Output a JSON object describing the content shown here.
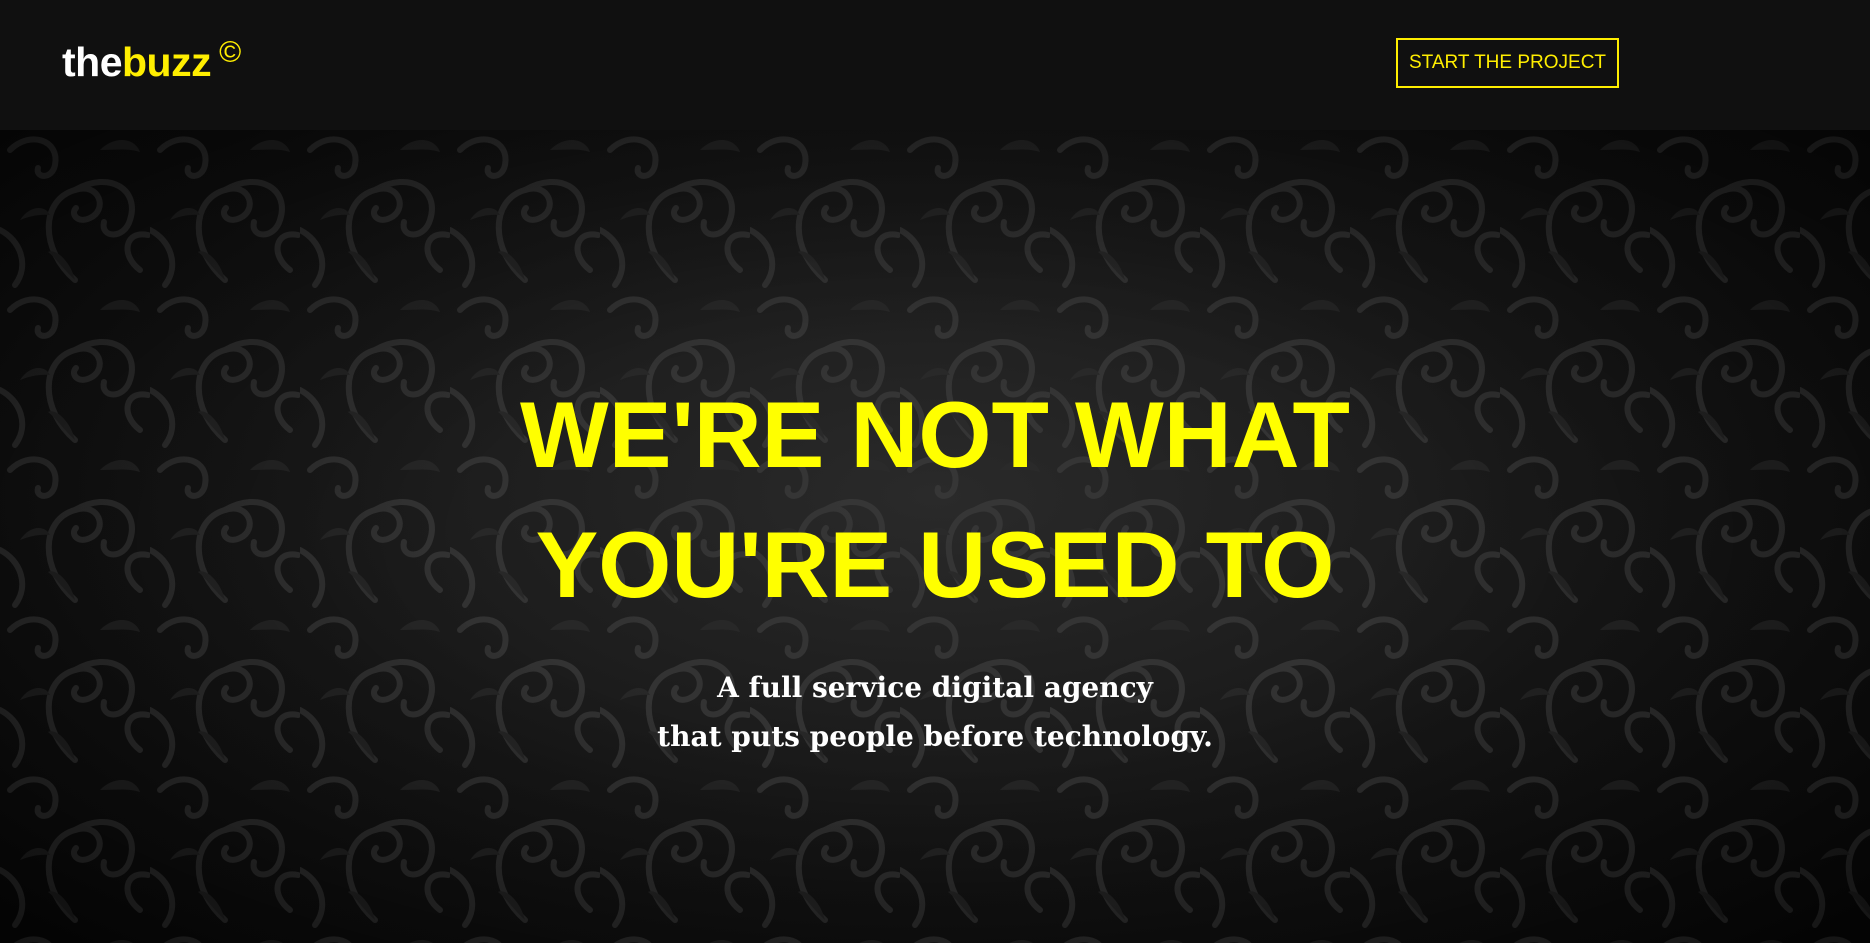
{
  "header": {
    "logo": {
      "part1": "the",
      "part2": "buzz",
      "mark": "©"
    },
    "cta_label": "START THE PROJECT"
  },
  "hero": {
    "headline_line1": "WE'RE NOT WHAT",
    "headline_line2": "YOU'RE USED TO",
    "sub_line1": "A full service digital agency",
    "sub_line2": "that puts people before technology."
  },
  "colors": {
    "accent": "#ffee00",
    "header_bg": "#101010",
    "text_light": "#ffffff"
  }
}
